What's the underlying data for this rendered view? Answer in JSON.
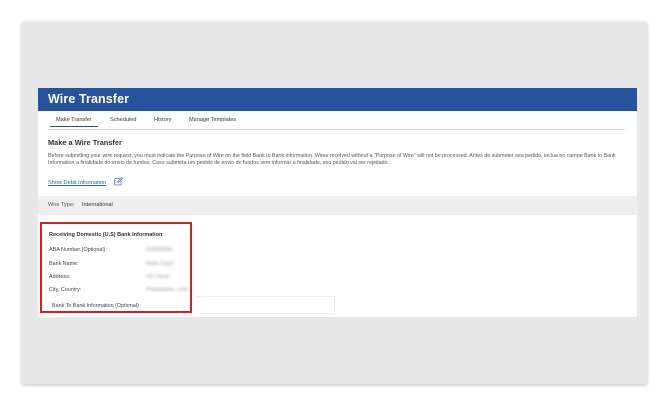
{
  "header": {
    "title": "Wire Transfer"
  },
  "tabs": [
    {
      "label": "Make Transfer",
      "active": true
    },
    {
      "label": "Scheduled"
    },
    {
      "label": "History"
    },
    {
      "label": "Manage Templates"
    }
  ],
  "main": {
    "heading": "Make a Wire Transfer",
    "description": "Before submitting your wire request, you must indicate the Purpose of Wire on the field Bank to Bank information. Wires received without a \"Purpose of Wire\" will not be processed. Antes de submeter seu pedido, inclua no campe Bank to Bank Information a finalidade do envio de fundos. Caso submeta um pedido de envio de fundos sem informar a finalidade, seu pedido vai ser rejeitado.",
    "debit_link": "Show Debit Information",
    "wire_type_label": "Wire Type:",
    "wire_type_value": "International"
  },
  "bank_info": {
    "title": "Receiving Domestic (U.S) Bank Information",
    "rows": [
      {
        "label": "ABA Number (Optional):",
        "value": "026009593"
      },
      {
        "label": "Bank Name:",
        "value": "Wells Fargo"
      },
      {
        "label": "Address:",
        "value": "123 Street"
      },
      {
        "label": "City, Country:",
        "value": "Philadelphia, USA"
      }
    ],
    "b2b_label": "Bank To Bank Information (Optional)"
  },
  "colors": {
    "header_bg": "#26539b",
    "highlight_border": "#d42020",
    "link": "#2a63c4"
  },
  "icons": {
    "edit": "edit-icon"
  }
}
